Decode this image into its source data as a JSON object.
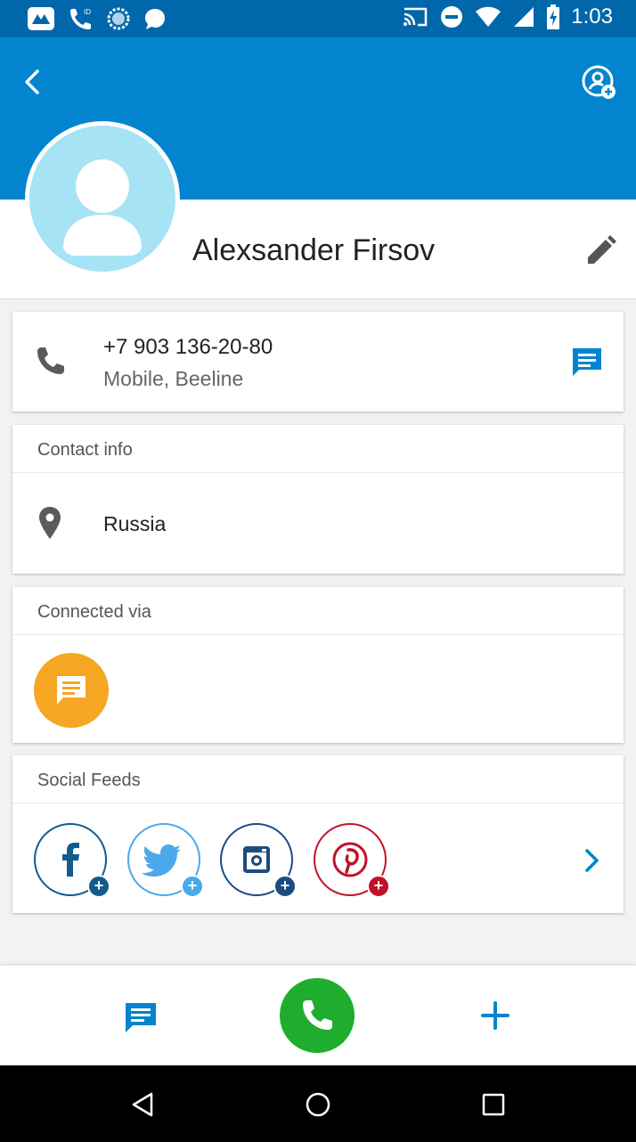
{
  "status_bar": {
    "time": "1:03",
    "icons": [
      "app-icon",
      "wifi-calling-icon",
      "data-saver-icon",
      "chat-bubble-icon",
      "cast-icon",
      "do-not-disturb-icon",
      "wifi-icon",
      "signal-icon",
      "battery-charging-icon"
    ]
  },
  "header": {
    "back_icon": "chevron-left-icon",
    "add_profile_icon": "profile-add-icon"
  },
  "contact": {
    "name": "Alexsander Firsov",
    "edit_icon": "pencil-icon"
  },
  "phone": {
    "number": "+7 903 136-20-80",
    "type": "Mobile, Beeline"
  },
  "contact_info": {
    "header": "Contact info",
    "location": "Russia"
  },
  "connected_via": {
    "header": "Connected via",
    "app_icon": "message-icon",
    "app_color": "#f5a623"
  },
  "social_feeds": {
    "header": "Social Feeds",
    "items": [
      {
        "name": "facebook",
        "color": "#125b8f"
      },
      {
        "name": "twitter",
        "color": "#4ba9ea"
      },
      {
        "name": "instagram",
        "color": "#1b4c80"
      },
      {
        "name": "pinterest",
        "color": "#c2112a"
      }
    ]
  },
  "colors": {
    "primary": "#0284cf",
    "status_bar": "#0167ab",
    "call_green": "#1fad2f"
  }
}
